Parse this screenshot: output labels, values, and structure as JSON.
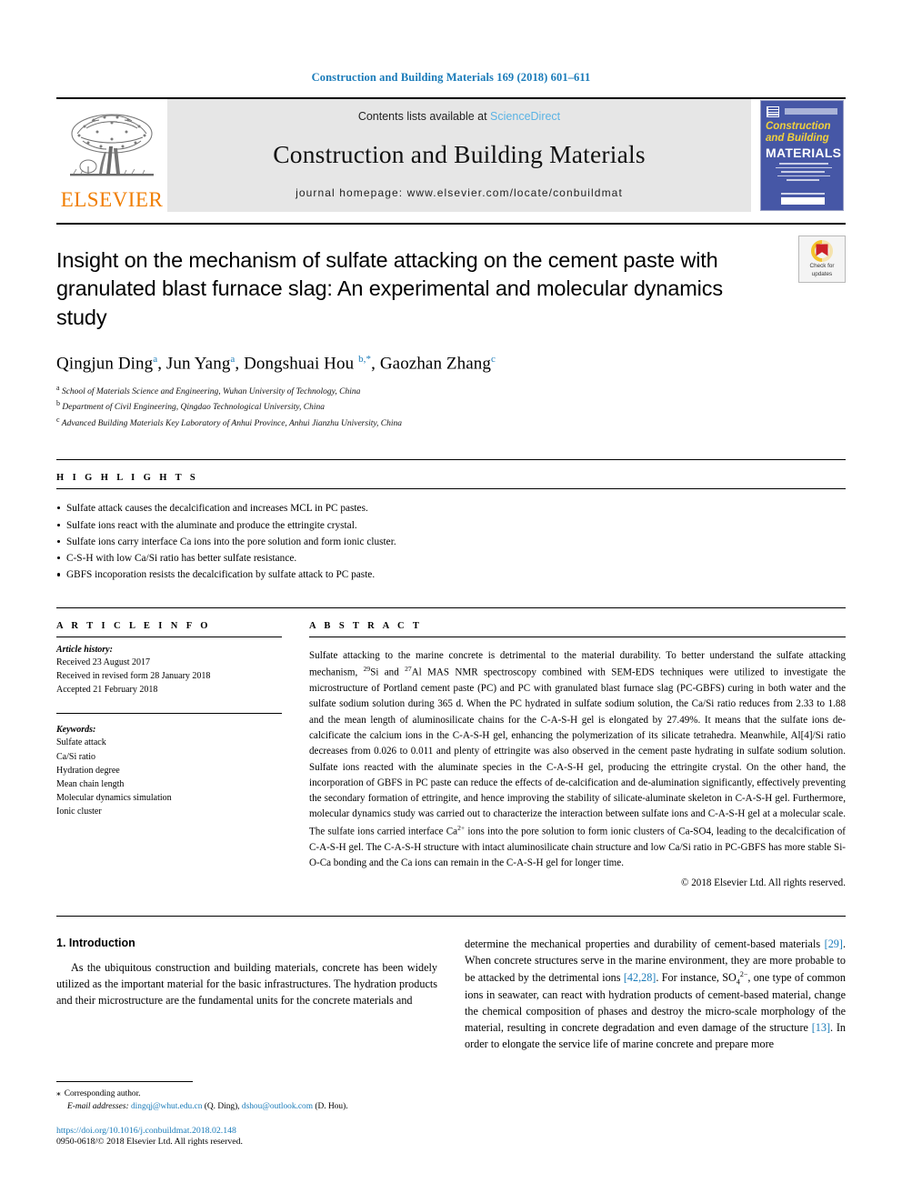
{
  "running_head": "Construction and Building Materials 169 (2018) 601–611",
  "masthead": {
    "publisher": "ELSEVIER",
    "contents_prefix": "Contents lists available at ",
    "contents_link": "ScienceDirect",
    "journal_name": "Construction and Building Materials",
    "homepage": "journal homepage: www.elsevier.com/locate/conbuildmat",
    "cover": {
      "line1": "Construction",
      "line2": "and Building",
      "line3": "MATERIALS"
    }
  },
  "crossmark": {
    "line1": "Check for",
    "line2": "updates"
  },
  "article": {
    "title": "Insight on the mechanism of sulfate attacking on the cement paste with granulated blast furnace slag: An experimental and molecular dynamics study",
    "authors": [
      {
        "name": "Qingjun Ding",
        "sup": "a"
      },
      {
        "name": "Jun Yang",
        "sup": "a"
      },
      {
        "name": "Dongshuai Hou",
        "sup": "b,*"
      },
      {
        "name": "Gaozhan Zhang",
        "sup": "c"
      }
    ],
    "affiliations": [
      {
        "sup": "a",
        "text": "School of Materials Science and Engineering, Wuhan University of Technology, China"
      },
      {
        "sup": "b",
        "text": "Department of Civil Engineering, Qingdao Technological University, China"
      },
      {
        "sup": "c",
        "text": "Advanced Building Materials Key Laboratory of Anhui Province, Anhui Jianzhu University, China"
      }
    ]
  },
  "highlights": {
    "label": "H I G H L I G H T S",
    "items": [
      "Sulfate attack causes the decalcification and increases MCL in PC pastes.",
      "Sulfate ions react with the aluminate and produce the ettringite crystal.",
      "Sulfate ions carry interface Ca ions into the pore solution and form ionic cluster.",
      "C-S-H with low Ca/Si ratio has better sulfate resistance.",
      "GBFS incoporation resists the decalcification by sulfate attack to PC paste."
    ]
  },
  "article_info": {
    "label": "A R T I C L E   I N F O",
    "history_title": "Article history:",
    "history": [
      "Received 23 August 2017",
      "Received in revised form 28 January 2018",
      "Accepted 21 February 2018"
    ],
    "keywords_title": "Keywords:",
    "keywords": [
      "Sulfate attack",
      "Ca/Si ratio",
      "Hydration degree",
      "Mean chain length",
      "Molecular dynamics simulation",
      "Ionic cluster"
    ]
  },
  "abstract": {
    "label": "A B S T R A C T",
    "part1": "Sulfate attacking to the marine concrete is detrimental to the material durability. To better understand the sulfate attacking mechanism, ",
    "sup1": "29",
    "mid1": "Si and ",
    "sup2": "27",
    "part2": "Al MAS NMR spectroscopy combined with SEM-EDS techniques were utilized to investigate the microstructure of Portland cement paste (PC) and PC with granulated blast furnace slag (PC-GBFS) curing in both water and the sulfate sodium solution during 365 d. When the PC hydrated in sulfate sodium solution, the Ca/Si ratio reduces from 2.33 to 1.88 and the mean length of aluminosilicate chains for the C-A-S-H gel is elongated by 27.49%. It means that the sulfate ions de-calcificate the calcium ions in the C-A-S-H gel, enhancing the polymerization of its silicate tetrahedra. Meanwhile, Al[4]/Si ratio decreases from 0.026 to 0.011 and plenty of ettringite was also observed in the cement paste hydrating in sulfate sodium solution. Sulfate ions reacted with the aluminate species in the C-A-S-H gel, producing the ettringite crystal. On the other hand, the incorporation of GBFS in PC paste can reduce the effects of de-calcification and de-alumination significantly, effectively preventing the secondary formation of ettringite, and hence improving the stability of silicate-aluminate skeleton in C-A-S-H gel. Furthermore, molecular dynamics study was carried out to characterize the interaction between sulfate ions and C-A-S-H gel at a molecular scale. The sulfate ions carried interface Ca",
    "sup3": "2+",
    "part3": " ions into the pore solution to form ionic clusters of Ca-SO4, leading to the decalcification of C-A-S-H gel. The C-A-S-H structure with intact aluminosilicate chain structure and low Ca/Si ratio in PC-GBFS has more stable Si-O-Ca bonding and the Ca ions can remain in the C-A-S-H gel for longer time.",
    "copyright": "© 2018 Elsevier Ltd. All rights reserved."
  },
  "introduction": {
    "heading": "1. Introduction",
    "left_paragraph": "As the ubiquitous construction and building materials, concrete has been widely utilized as the important material for the basic infrastructures. The hydration products and their microstructure are the fundamental units for the concrete materials and",
    "right_part1": "determine the mechanical properties and durability of cement-based materials ",
    "right_cite1": "[29]",
    "right_part2": ". When concrete structures serve in the marine environment, they are more probable to be attacked by the detrimental ions ",
    "right_cite2": "[42,28]",
    "right_part3": ". For instance, SO",
    "right_sub": "4",
    "right_sup": "2−",
    "right_part4": ", one type of common ions in seawater, can react with hydration products of cement-based material, change the chemical composition of phases and destroy the micro-scale morphology of the material, resulting in concrete degradation and even damage of the structure ",
    "right_cite3": "[13]",
    "right_part5": ". In order to elongate the service life of marine concrete and prepare more"
  },
  "footnotes": {
    "corresponding_star": "⁎",
    "corresponding": "Corresponding author.",
    "email_label": "E-mail addresses:",
    "email1": "dingqj@whut.edu.cn",
    "email1_owner": "(Q. Ding),",
    "email2": "dshou@outlook.com",
    "email2_owner": "(D. Hou).",
    "doi": "https://doi.org/10.1016/j.conbuildmat.2018.02.148",
    "issn": "0950-0618/© 2018 Elsevier Ltd. All rights reserved."
  },
  "colors": {
    "link_blue": "#1a7bb9",
    "sciencedirect_blue": "#5bb3e4",
    "elsevier_orange": "#f07d00",
    "cover_blue": "#4657a6",
    "cover_yellow": "#f2d13c"
  }
}
